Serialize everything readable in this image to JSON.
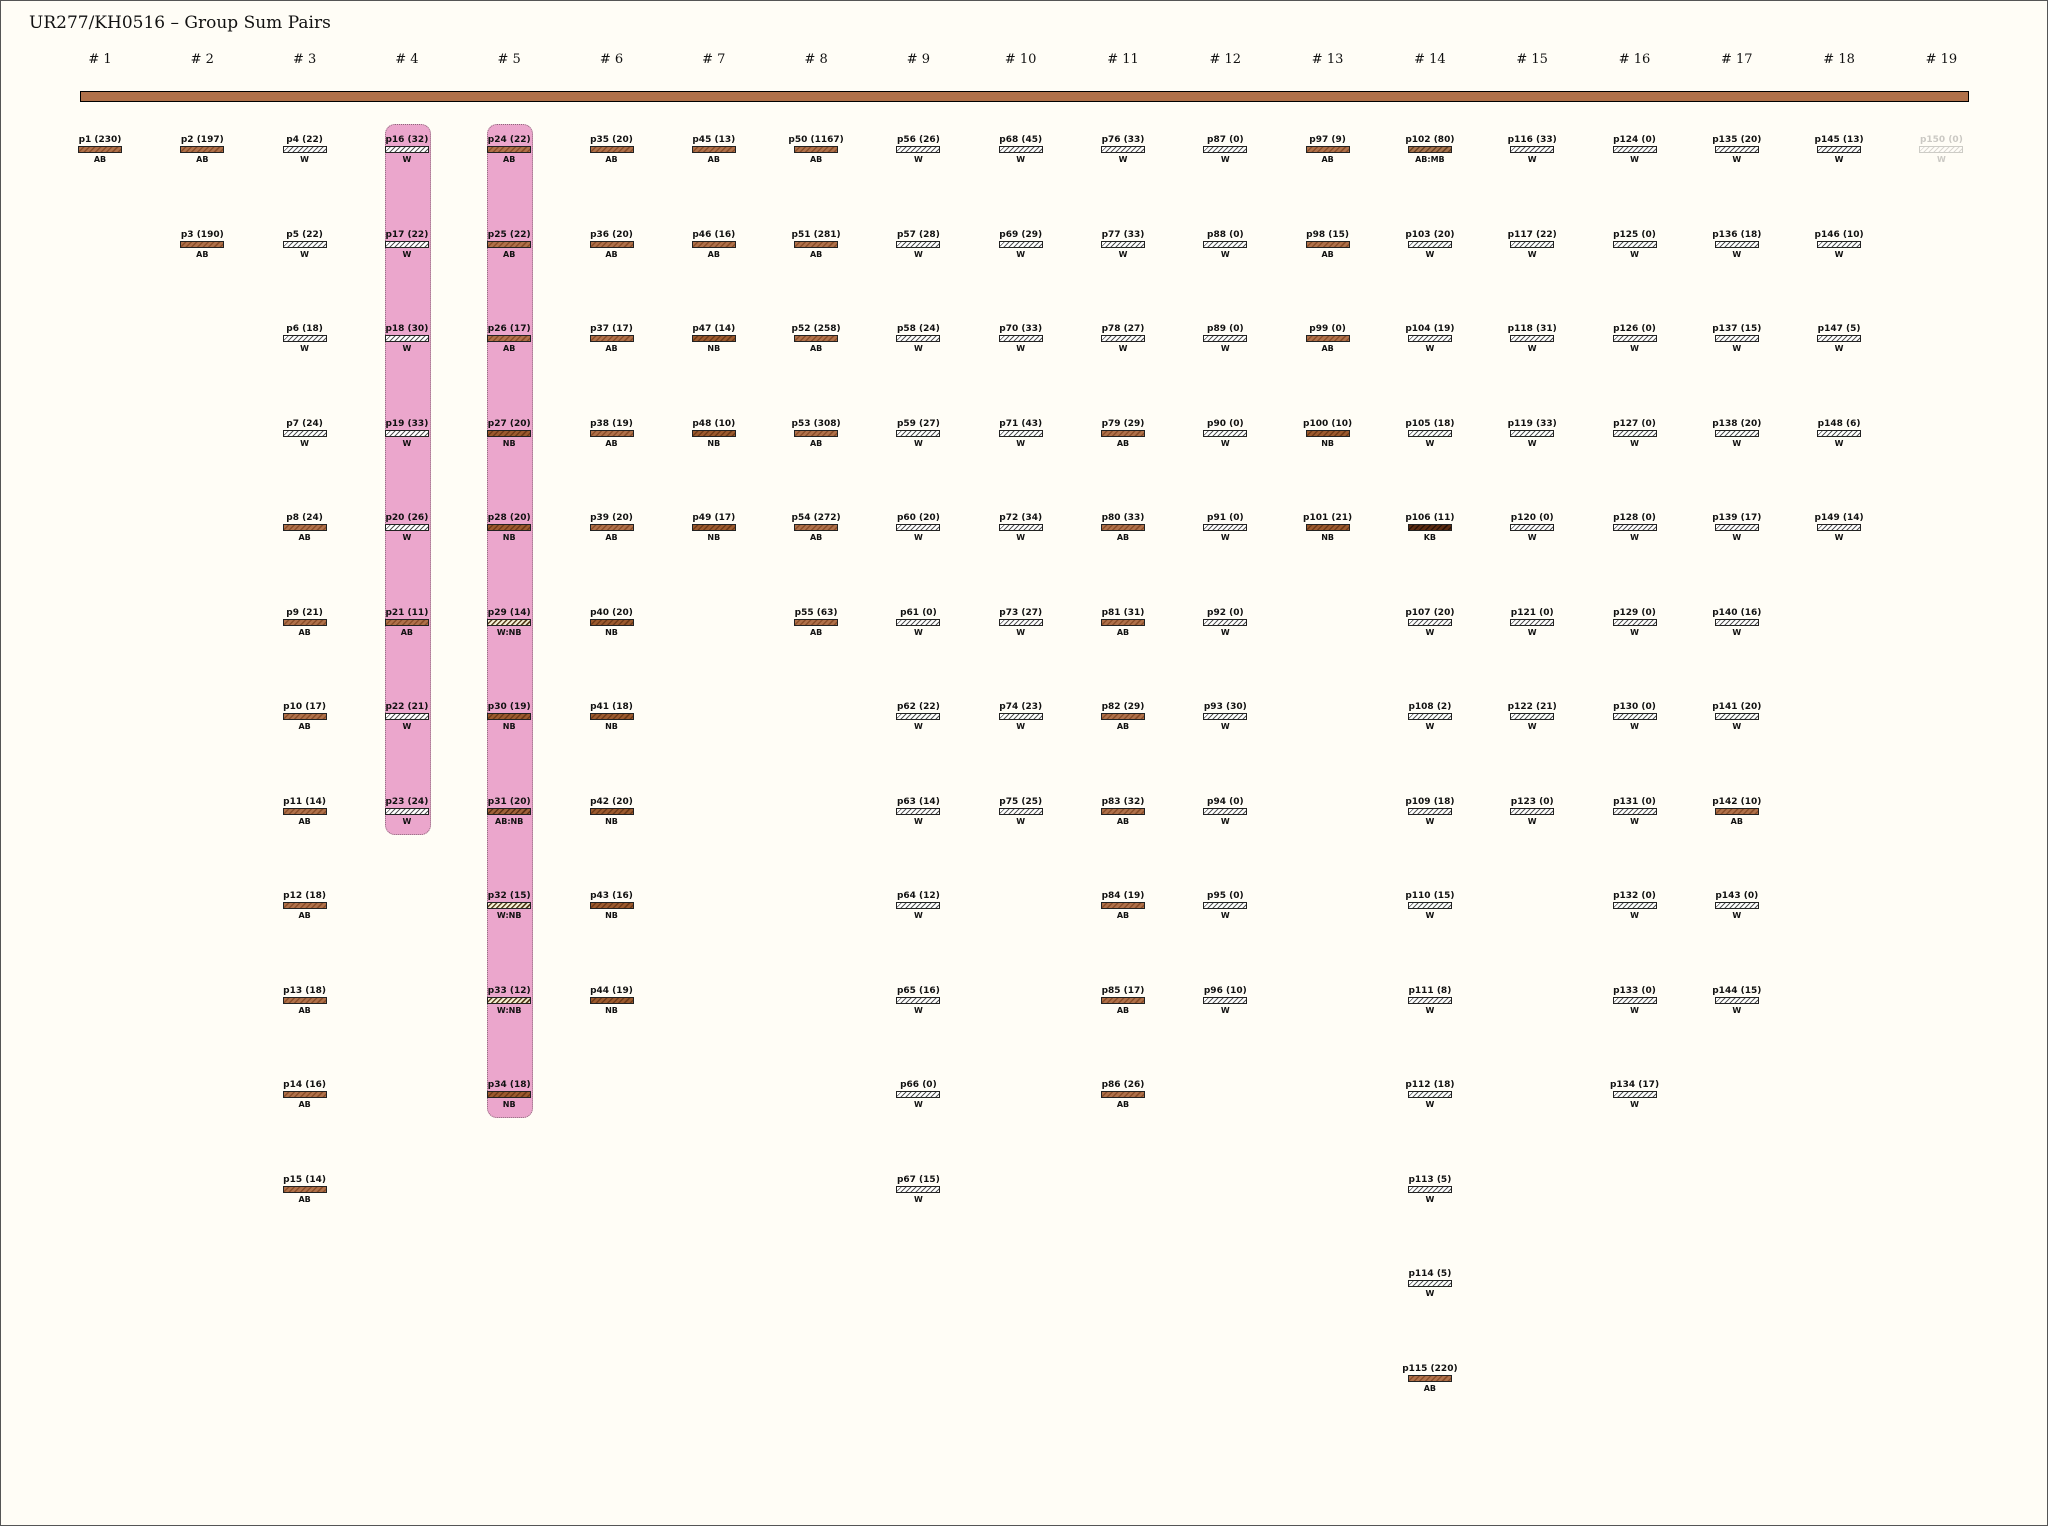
{
  "title": "UR277/KH0516 – Group Sum Pairs",
  "colors": {
    "canvas": "#fffdf6",
    "main_bar": "#b0714a",
    "group_highlight": "#eba6cc",
    "AB": "#b0714a",
    "NB": "#9c5a2e",
    "KB": "#3a1a08",
    "W": "#ffffff"
  },
  "highlighted_groups": [
    "# 4",
    "# 5"
  ],
  "groups": [
    {
      "name": "# 1",
      "items": [
        {
          "label": "p1 (230)",
          "type": "AB"
        }
      ]
    },
    {
      "name": "# 2",
      "items": [
        {
          "label": "p2 (197)",
          "type": "AB"
        },
        {
          "label": "p3 (190)",
          "type": "AB"
        }
      ]
    },
    {
      "name": "# 3",
      "items": [
        {
          "label": "p4 (22)",
          "type": "W"
        },
        {
          "label": "p5 (22)",
          "type": "W"
        },
        {
          "label": "p6 (18)",
          "type": "W"
        },
        {
          "label": "p7 (24)",
          "type": "W"
        },
        {
          "label": "p8 (24)",
          "type": "AB"
        },
        {
          "label": "p9 (21)",
          "type": "AB"
        },
        {
          "label": "p10 (17)",
          "type": "AB"
        },
        {
          "label": "p11 (14)",
          "type": "AB"
        },
        {
          "label": "p12 (18)",
          "type": "AB"
        },
        {
          "label": "p13 (18)",
          "type": "AB"
        },
        {
          "label": "p14 (16)",
          "type": "AB"
        },
        {
          "label": "p15 (14)",
          "type": "AB"
        }
      ]
    },
    {
      "name": "# 4",
      "items": [
        {
          "label": "p16 (32)",
          "type": "W"
        },
        {
          "label": "p17 (22)",
          "type": "W"
        },
        {
          "label": "p18 (30)",
          "type": "W"
        },
        {
          "label": "p19 (33)",
          "type": "W"
        },
        {
          "label": "p20 (26)",
          "type": "W"
        },
        {
          "label": "p21 (11)",
          "type": "AB"
        },
        {
          "label": "p22 (21)",
          "type": "W"
        },
        {
          "label": "p23 (24)",
          "type": "W"
        }
      ]
    },
    {
      "name": "# 5",
      "items": [
        {
          "label": "p24 (22)",
          "type": "AB"
        },
        {
          "label": "p25 (22)",
          "type": "AB"
        },
        {
          "label": "p26 (17)",
          "type": "AB"
        },
        {
          "label": "p27 (20)",
          "type": "NB"
        },
        {
          "label": "p28 (20)",
          "type": "NB"
        },
        {
          "label": "p29 (14)",
          "type": "W:NB"
        },
        {
          "label": "p30 (19)",
          "type": "NB"
        },
        {
          "label": "p31 (20)",
          "type": "AB:NB"
        },
        {
          "label": "p32 (15)",
          "type": "W:NB"
        },
        {
          "label": "p33 (12)",
          "type": "W:NB"
        },
        {
          "label": "p34 (18)",
          "type": "NB"
        }
      ]
    },
    {
      "name": "# 6",
      "items": [
        {
          "label": "p35 (20)",
          "type": "AB"
        },
        {
          "label": "p36 (20)",
          "type": "AB"
        },
        {
          "label": "p37 (17)",
          "type": "AB"
        },
        {
          "label": "p38 (19)",
          "type": "AB"
        },
        {
          "label": "p39 (20)",
          "type": "AB"
        },
        {
          "label": "p40 (20)",
          "type": "NB"
        },
        {
          "label": "p41 (18)",
          "type": "NB"
        },
        {
          "label": "p42 (20)",
          "type": "NB"
        },
        {
          "label": "p43 (16)",
          "type": "NB"
        },
        {
          "label": "p44 (19)",
          "type": "NB"
        }
      ]
    },
    {
      "name": "# 7",
      "items": [
        {
          "label": "p45 (13)",
          "type": "AB"
        },
        {
          "label": "p46 (16)",
          "type": "AB"
        },
        {
          "label": "p47 (14)",
          "type": "NB"
        },
        {
          "label": "p48 (10)",
          "type": "NB"
        },
        {
          "label": "p49 (17)",
          "type": "NB"
        }
      ]
    },
    {
      "name": "# 8",
      "items": [
        {
          "label": "p50 (1167)",
          "type": "AB"
        },
        {
          "label": "p51 (281)",
          "type": "AB"
        },
        {
          "label": "p52 (258)",
          "type": "AB"
        },
        {
          "label": "p53 (308)",
          "type": "AB"
        },
        {
          "label": "p54 (272)",
          "type": "AB"
        },
        {
          "label": "p55 (63)",
          "type": "AB"
        }
      ]
    },
    {
      "name": "# 9",
      "items": [
        {
          "label": "p56 (26)",
          "type": "W"
        },
        {
          "label": "p57 (28)",
          "type": "W"
        },
        {
          "label": "p58 (24)",
          "type": "W"
        },
        {
          "label": "p59 (27)",
          "type": "W"
        },
        {
          "label": "p60 (20)",
          "type": "W"
        },
        {
          "label": "p61 (0)",
          "type": "W"
        },
        {
          "label": "p62 (22)",
          "type": "W"
        },
        {
          "label": "p63 (14)",
          "type": "W"
        },
        {
          "label": "p64 (12)",
          "type": "W"
        },
        {
          "label": "p65 (16)",
          "type": "W"
        },
        {
          "label": "p66 (0)",
          "type": "W"
        },
        {
          "label": "p67 (15)",
          "type": "W"
        }
      ]
    },
    {
      "name": "# 10",
      "items": [
        {
          "label": "p68 (45)",
          "type": "W"
        },
        {
          "label": "p69 (29)",
          "type": "W"
        },
        {
          "label": "p70 (33)",
          "type": "W"
        },
        {
          "label": "p71 (43)",
          "type": "W"
        },
        {
          "label": "p72 (34)",
          "type": "W"
        },
        {
          "label": "p73 (27)",
          "type": "W"
        },
        {
          "label": "p74 (23)",
          "type": "W"
        },
        {
          "label": "p75 (25)",
          "type": "W"
        }
      ]
    },
    {
      "name": "# 11",
      "items": [
        {
          "label": "p76 (33)",
          "type": "W"
        },
        {
          "label": "p77 (33)",
          "type": "W"
        },
        {
          "label": "p78 (27)",
          "type": "W"
        },
        {
          "label": "p79 (29)",
          "type": "AB"
        },
        {
          "label": "p80 (33)",
          "type": "AB"
        },
        {
          "label": "p81 (31)",
          "type": "AB"
        },
        {
          "label": "p82 (29)",
          "type": "AB"
        },
        {
          "label": "p83 (32)",
          "type": "AB"
        },
        {
          "label": "p84 (19)",
          "type": "AB"
        },
        {
          "label": "p85 (17)",
          "type": "AB"
        },
        {
          "label": "p86 (26)",
          "type": "AB"
        }
      ]
    },
    {
      "name": "# 12",
      "items": [
        {
          "label": "p87 (0)",
          "type": "W"
        },
        {
          "label": "p88 (0)",
          "type": "W"
        },
        {
          "label": "p89 (0)",
          "type": "W"
        },
        {
          "label": "p90 (0)",
          "type": "W"
        },
        {
          "label": "p91 (0)",
          "type": "W"
        },
        {
          "label": "p92 (0)",
          "type": "W"
        },
        {
          "label": "p93 (30)",
          "type": "W"
        },
        {
          "label": "p94 (0)",
          "type": "W"
        },
        {
          "label": "p95 (0)",
          "type": "W"
        },
        {
          "label": "p96 (10)",
          "type": "W"
        }
      ]
    },
    {
      "name": "# 13",
      "items": [
        {
          "label": "p97 (9)",
          "type": "AB"
        },
        {
          "label": "p98 (15)",
          "type": "AB"
        },
        {
          "label": "p99 (0)",
          "type": "AB"
        },
        {
          "label": "p100 (10)",
          "type": "NB"
        },
        {
          "label": "p101 (21)",
          "type": "NB"
        }
      ]
    },
    {
      "name": "# 14",
      "items": [
        {
          "label": "p102 (80)",
          "type": "AB:MB"
        },
        {
          "label": "p103 (20)",
          "type": "W"
        },
        {
          "label": "p104 (19)",
          "type": "W"
        },
        {
          "label": "p105 (18)",
          "type": "W"
        },
        {
          "label": "p106 (11)",
          "type": "KB"
        },
        {
          "label": "p107 (20)",
          "type": "W"
        },
        {
          "label": "p108 (2)",
          "type": "W"
        },
        {
          "label": "p109 (18)",
          "type": "W"
        },
        {
          "label": "p110 (15)",
          "type": "W"
        },
        {
          "label": "p111 (8)",
          "type": "W"
        },
        {
          "label": "p112 (18)",
          "type": "W"
        },
        {
          "label": "p113 (5)",
          "type": "W"
        },
        {
          "label": "p114 (5)",
          "type": "W"
        },
        {
          "label": "p115 (220)",
          "type": "AB"
        }
      ]
    },
    {
      "name": "# 15",
      "items": [
        {
          "label": "p116 (33)",
          "type": "W"
        },
        {
          "label": "p117 (22)",
          "type": "W"
        },
        {
          "label": "p118 (31)",
          "type": "W"
        },
        {
          "label": "p119 (33)",
          "type": "W"
        },
        {
          "label": "p120 (0)",
          "type": "W"
        },
        {
          "label": "p121 (0)",
          "type": "W"
        },
        {
          "label": "p122 (21)",
          "type": "W"
        },
        {
          "label": "p123 (0)",
          "type": "W"
        }
      ]
    },
    {
      "name": "# 16",
      "items": [
        {
          "label": "p124 (0)",
          "type": "W"
        },
        {
          "label": "p125 (0)",
          "type": "W"
        },
        {
          "label": "p126 (0)",
          "type": "W"
        },
        {
          "label": "p127 (0)",
          "type": "W"
        },
        {
          "label": "p128 (0)",
          "type": "W"
        },
        {
          "label": "p129 (0)",
          "type": "W"
        },
        {
          "label": "p130 (0)",
          "type": "W"
        },
        {
          "label": "p131 (0)",
          "type": "W"
        },
        {
          "label": "p132 (0)",
          "type": "W"
        },
        {
          "label": "p133 (0)",
          "type": "W"
        },
        {
          "label": "p134 (17)",
          "type": "W"
        }
      ]
    },
    {
      "name": "# 17",
      "items": [
        {
          "label": "p135 (20)",
          "type": "W"
        },
        {
          "label": "p136 (18)",
          "type": "W"
        },
        {
          "label": "p137 (15)",
          "type": "W"
        },
        {
          "label": "p138 (20)",
          "type": "W"
        },
        {
          "label": "p139 (17)",
          "type": "W"
        },
        {
          "label": "p140 (16)",
          "type": "W"
        },
        {
          "label": "p141 (20)",
          "type": "W"
        },
        {
          "label": "p142 (10)",
          "type": "AB"
        },
        {
          "label": "p143 (0)",
          "type": "W"
        },
        {
          "label": "p144 (15)",
          "type": "W"
        }
      ]
    },
    {
      "name": "# 18",
      "items": [
        {
          "label": "p145 (13)",
          "type": "W"
        },
        {
          "label": "p146 (10)",
          "type": "W"
        },
        {
          "label": "p147 (5)",
          "type": "W"
        },
        {
          "label": "p148 (6)",
          "type": "W"
        },
        {
          "label": "p149 (14)",
          "type": "W"
        }
      ]
    },
    {
      "name": "# 19",
      "items": [
        {
          "label": "p150 (0)",
          "type": "W",
          "faded": true
        }
      ]
    }
  ]
}
